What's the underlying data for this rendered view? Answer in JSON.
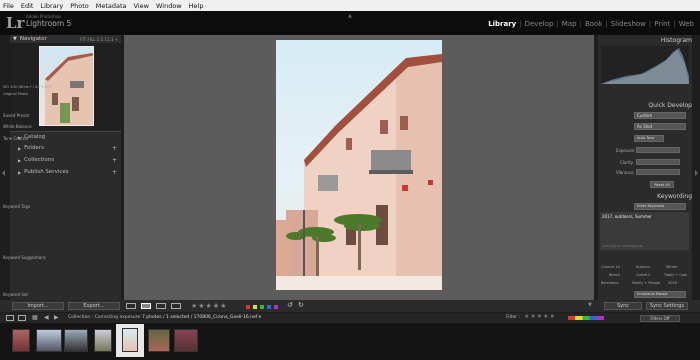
{
  "menu": [
    "File",
    "Edit",
    "Library",
    "Photo",
    "Metadata",
    "View",
    "Window",
    "Help"
  ],
  "app": {
    "lr": "Lr",
    "small": "Adobe Photoshop",
    "name": "Lightroom 5"
  },
  "modules": [
    "Library",
    "Develop",
    "Map",
    "Book",
    "Slideshow",
    "Print",
    "Web"
  ],
  "navigator": {
    "title": "Navigator",
    "zoom": "FIT  FILL  1:1  11:1 ÷"
  },
  "left_sections": [
    "Catalog",
    "Folders",
    "Collections",
    "Publish Services"
  ],
  "left_buttons": {
    "import": "Import...",
    "export": "Export..."
  },
  "histogram": {
    "title": "Histogram",
    "readout": "ISO 100   16mm   f / 4.0   1/500",
    "original": "Original Photo"
  },
  "quick_develop": {
    "title": "Quick Develop",
    "saved_preset": "Saved Preset",
    "saved_value": "Custom",
    "white_balance": "White Balance",
    "wb_value": "As Shot",
    "tone_control": "Tone Control",
    "auto_tone": "Auto Tone",
    "exposure": "Exposure",
    "clarity": "Clarity",
    "vibrance": "Vibrance",
    "reset": "Reset All"
  },
  "keywording": {
    "title": "Keywording",
    "tags_label": "Keyword Tags",
    "tags_value": "Enter Keywords",
    "keywords": "2017, outdoors, Summer",
    "hint": "Click here to add keywords",
    "suggestions": "Keyword Suggestions",
    "suggestion_words": [
      "Chance 14",
      "Autumn",
      "Winter",
      "Beach",
      "Colorful",
      "Tropic + Cool",
      "Barcelona",
      "Family + People",
      "2016"
    ],
    "set_label": "Keyword Set",
    "set_value": "Emotional Mosaic"
  },
  "right_buttons": {
    "sync": "Sync",
    "sync_settings": "Sync Settings"
  },
  "toolbar": {
    "stars": "★★★★★",
    "colors": [
      "#d33",
      "#dd3",
      "#3b3",
      "#36d",
      "#a3c"
    ]
  },
  "filmbar": {
    "label": "Collection : Correcting exposure",
    "count": "7 photos / 1 selected / 170806_Cirona_Gaell-16.nef ▾",
    "filter": "Filter :",
    "filters_off": "Filters Off"
  }
}
